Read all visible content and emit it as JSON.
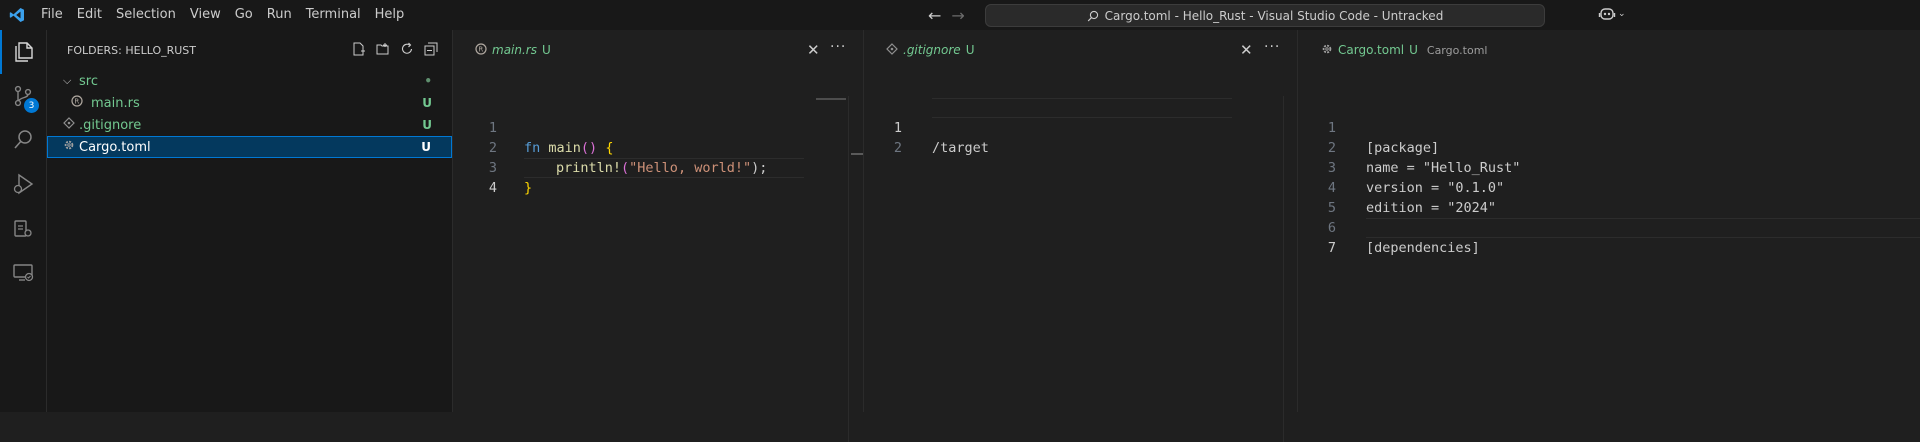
{
  "titlebar": {
    "menu": [
      "File",
      "Edit",
      "Selection",
      "View",
      "Go",
      "Run",
      "Terminal",
      "Help"
    ],
    "command_center": "Cargo.toml - Hello_Rust - Visual Studio Code - Untracked"
  },
  "activity_bar": {
    "source_control_badge": "3",
    "icons": [
      "explorer-icon",
      "source-control-icon",
      "search-icon",
      "run-debug-icon",
      "extensions-icon",
      "remote-explorer-icon"
    ]
  },
  "explorer": {
    "header": "FOLDERS: HELLO_RUST",
    "tree": [
      {
        "label": "src",
        "type": "folder",
        "status": "•"
      },
      {
        "label": "main.rs",
        "type": "file",
        "status": "U"
      },
      {
        "label": ".gitignore",
        "type": "file",
        "status": "U"
      },
      {
        "label": "Cargo.toml",
        "type": "file",
        "status": "U",
        "selected": true
      }
    ]
  },
  "editors": {
    "main_rs": {
      "tab_name": "main.rs",
      "tab_status": "U",
      "line_numbers": [
        "1",
        "2",
        "3",
        "4"
      ],
      "code": {
        "l1_kw": "fn",
        "l1_name": "main",
        "l1_parens": "()",
        "l1_brace": "{",
        "l2_macro": "println!",
        "l2_open": "(",
        "l2_str": "\"Hello, world!\"",
        "l2_close": ");",
        "l3_brace": "}"
      }
    },
    "gitignore": {
      "tab_name": ".gitignore",
      "tab_status": "U",
      "line_numbers": [
        "1",
        "2"
      ],
      "lines": [
        "/target",
        ""
      ]
    },
    "cargo_toml": {
      "tab_name": "Cargo.toml",
      "tab_status": "U",
      "tab_description": "Cargo.toml",
      "line_numbers": [
        "1",
        "2",
        "3",
        "4",
        "5",
        "6",
        "7"
      ],
      "lines": [
        "[package]",
        "name = \"Hello_Rust\"",
        "version = \"0.1.0\"",
        "edition = \"2024\"",
        "",
        "[dependencies]",
        ""
      ]
    }
  },
  "colors": {
    "accent": "#0078d4",
    "untracked": "#73c991",
    "editor_bg": "#1f1f1f",
    "chrome_bg": "#181818"
  }
}
